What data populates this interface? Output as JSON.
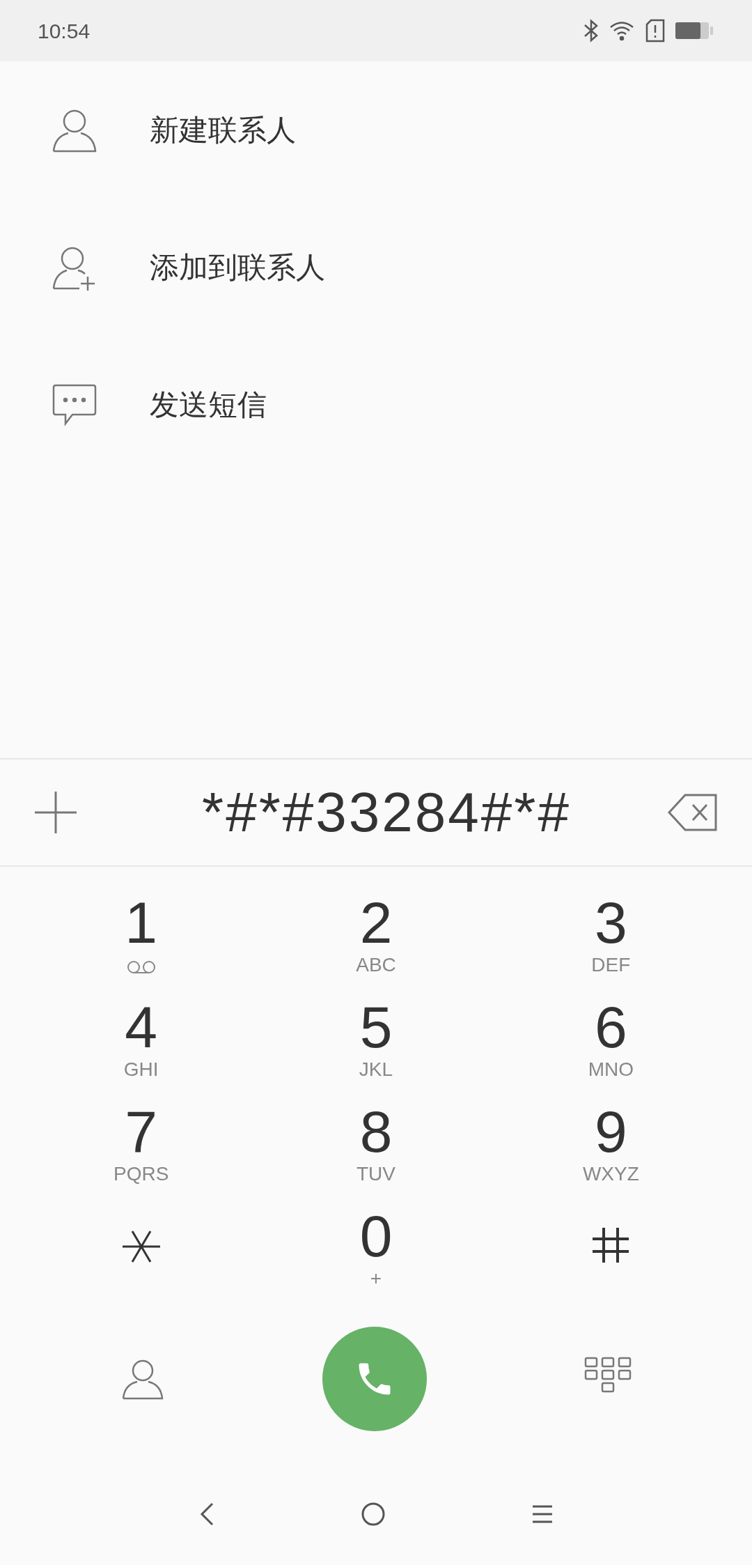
{
  "status_bar": {
    "time": "10:54"
  },
  "menu_items": [
    {
      "kind": "person",
      "label": "新建联系人"
    },
    {
      "kind": "person_add",
      "label": "添加到联系人"
    },
    {
      "kind": "message",
      "label": "发送短信"
    }
  ],
  "dial_input": {
    "value": "*#*#33284#*#"
  },
  "keypad": [
    {
      "kind": "voicemail_digit",
      "digit": "1"
    },
    {
      "kind": "digit",
      "digit": "2",
      "letters": "ABC"
    },
    {
      "kind": "digit",
      "digit": "3",
      "letters": "DEF"
    },
    {
      "kind": "digit",
      "digit": "4",
      "letters": "GHI"
    },
    {
      "kind": "digit",
      "digit": "5",
      "letters": "JKL"
    },
    {
      "kind": "digit",
      "digit": "6",
      "letters": "MNO"
    },
    {
      "kind": "digit",
      "digit": "7",
      "letters": "PQRS"
    },
    {
      "kind": "digit",
      "digit": "8",
      "letters": "TUV"
    },
    {
      "kind": "digit",
      "digit": "9",
      "letters": "WXYZ"
    },
    {
      "kind": "star"
    },
    {
      "kind": "digit",
      "digit": "0",
      "letters": "+"
    },
    {
      "kind": "hash"
    }
  ]
}
